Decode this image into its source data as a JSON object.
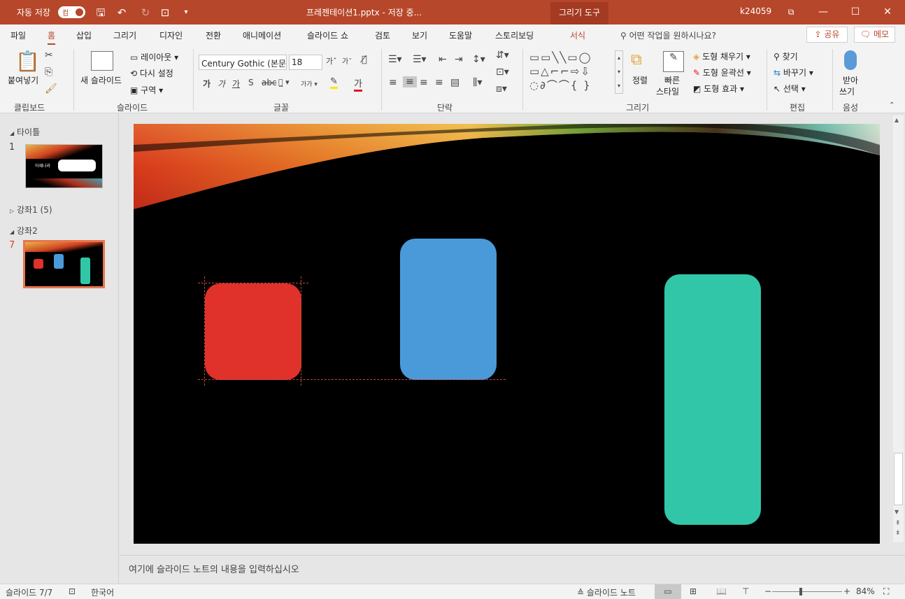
{
  "titlebar": {
    "autosave_label": "자동 저장",
    "autosave_state": "컴",
    "doc_title": "프레젠테이션1.pptx  -  저장 중...",
    "context_tab": "그리기 도구",
    "user": "k24059"
  },
  "tabs": [
    "파일",
    "홈",
    "삽입",
    "그리기",
    "디자인",
    "전환",
    "애니메이션",
    "슬라이드 쇼",
    "검토",
    "보기",
    "도움말",
    "스토리보딩",
    "서식"
  ],
  "active_tab": "홈",
  "tell_me": "어떤 작업을 원하시나요?",
  "share_label": "공유",
  "comment_label": "메모",
  "ribbon": {
    "clipboard": {
      "paste": "붙여넣기",
      "group": "클립보드"
    },
    "slides": {
      "new_slide": "새 슬라이드",
      "layout": "레이아웃",
      "reset": "다시 설정",
      "section": "구역",
      "group": "슬라이드"
    },
    "font": {
      "family": "Century Gothic (본문",
      "size": "18",
      "group": "글꼴"
    },
    "paragraph": {
      "group": "단락"
    },
    "drawing": {
      "arrange": "정렬",
      "quick_styles": "빠른\n스타일",
      "quick1": "빠른",
      "quick2": "스타일",
      "fill": "도형 채우기",
      "outline": "도형 윤곽선",
      "effects": "도형 효과",
      "group": "그리기"
    },
    "editing": {
      "find": "찾기",
      "replace": "바꾸기",
      "select": "선택",
      "group": "편집"
    },
    "voice": {
      "dictate1": "받아",
      "dictate2": "쓰기",
      "group": "음성"
    }
  },
  "left_pane": {
    "sections": [
      {
        "name": "타이틀"
      },
      {
        "name": "강좌1 (5)"
      },
      {
        "name": "강좌2"
      }
    ],
    "slide_numbers": [
      "1",
      "7"
    ],
    "thumb1_text": "아재나라"
  },
  "notes_placeholder": "여기에 슬라이드 노트의 내용을 입력하십시오",
  "statusbar": {
    "slide_info": "슬라이드 7/7",
    "language": "한국어",
    "notes_button": "슬라이드 노트",
    "zoom": "84%"
  },
  "colors": {
    "accent": "#b7472a",
    "red_shape": "#e0312b",
    "blue_shape": "#4a9ad9",
    "green_shape": "#32c6a8"
  }
}
